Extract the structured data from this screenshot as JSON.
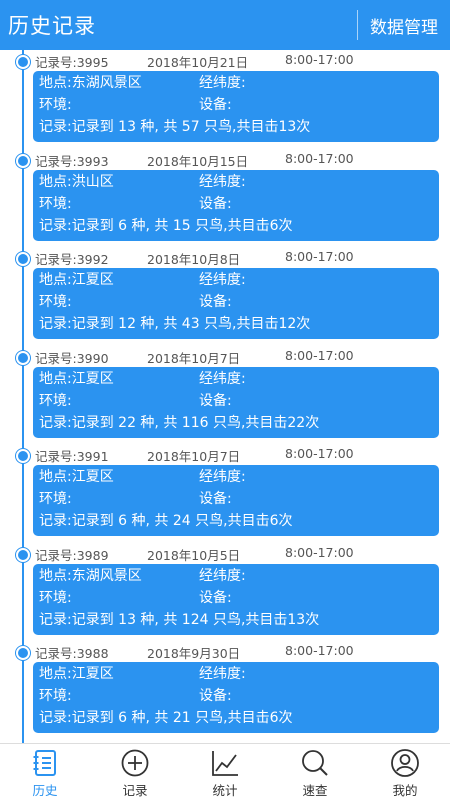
{
  "header": {
    "title": "历史记录",
    "action": "数据管理"
  },
  "labels": {
    "location": "地点:",
    "coords": "经纬度:",
    "environment": "环境:",
    "device": "设备:"
  },
  "records": [
    {
      "number": "记录号:3995",
      "date": "2018年10月21日",
      "time": "8:00-17:00",
      "location": "东湖风景区",
      "summary": "记录:记录到 13 种, 共 57 只鸟,共目击13次"
    },
    {
      "number": "记录号:3993",
      "date": "2018年10月15日",
      "time": "8:00-17:00",
      "location": "洪山区",
      "summary": "记录:记录到 6 种, 共 15 只鸟,共目击6次"
    },
    {
      "number": "记录号:3992",
      "date": "2018年10月8日",
      "time": "8:00-17:00",
      "location": "江夏区",
      "summary": "记录:记录到 12 种, 共 43 只鸟,共目击12次"
    },
    {
      "number": "记录号:3990",
      "date": "2018年10月7日",
      "time": "8:00-17:00",
      "location": "江夏区",
      "summary": "记录:记录到 22 种, 共 116 只鸟,共目击22次"
    },
    {
      "number": "记录号:3991",
      "date": "2018年10月7日",
      "time": "8:00-17:00",
      "location": "江夏区",
      "summary": "记录:记录到 6 种, 共 24 只鸟,共目击6次"
    },
    {
      "number": "记录号:3989",
      "date": "2018年10月5日",
      "time": "8:00-17:00",
      "location": "东湖风景区",
      "summary": "记录:记录到 13 种, 共 124 只鸟,共目击13次"
    },
    {
      "number": "记录号:3988",
      "date": "2018年9月30日",
      "time": "8:00-17:00",
      "location": "江夏区",
      "summary": "记录:记录到 6 种, 共 21 只鸟,共目击6次"
    }
  ],
  "tabs": [
    {
      "label": "历史",
      "icon": "history-list-icon",
      "active": true
    },
    {
      "label": "记录",
      "icon": "plus-circle-icon",
      "active": false
    },
    {
      "label": "统计",
      "icon": "chart-icon",
      "active": false
    },
    {
      "label": "速查",
      "icon": "search-icon",
      "active": false
    },
    {
      "label": "我的",
      "icon": "user-icon",
      "active": false
    }
  ],
  "colors": {
    "accent": "#2b93f0",
    "tab_inactive": "#333333"
  }
}
